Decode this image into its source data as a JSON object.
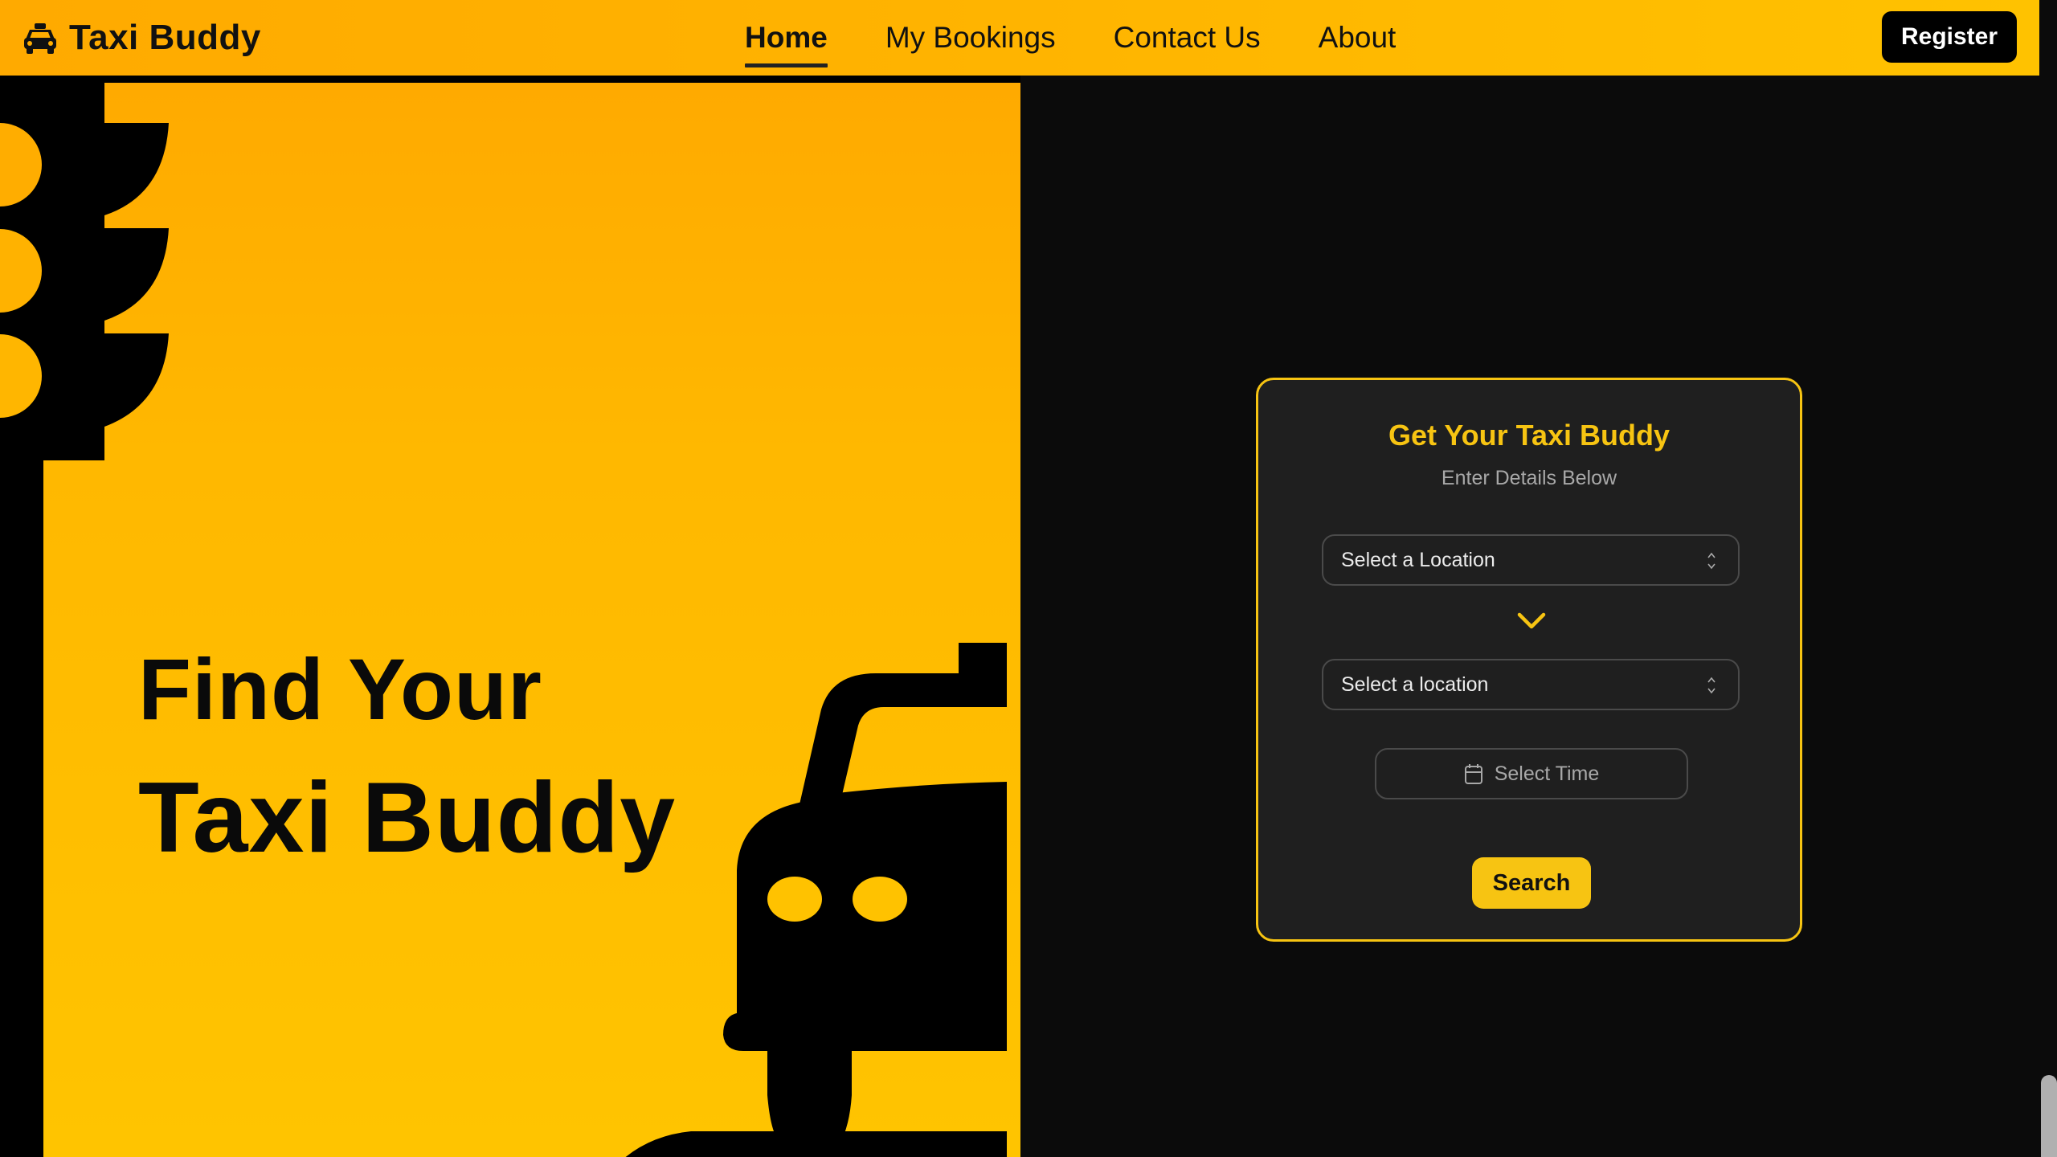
{
  "header": {
    "brand": "Taxi Buddy",
    "brand_icon": "taxi-icon",
    "nav": [
      {
        "label": "Home",
        "active": true
      },
      {
        "label": "My Bookings",
        "active": false
      },
      {
        "label": "Contact Us",
        "active": false
      },
      {
        "label": "About",
        "active": false
      }
    ],
    "register_label": "Register"
  },
  "hero": {
    "line1": "Find Your",
    "line2": "Taxi Buddy",
    "illustrations": [
      "traffic-light",
      "taxi-car"
    ]
  },
  "booking_card": {
    "title": "Get Your Taxi Buddy",
    "subtitle": "Enter Details Below",
    "pickup_select": {
      "value": "Select a Location"
    },
    "swap_icon": "chevron-down-icon",
    "dropoff_select": {
      "value": "Select a location"
    },
    "time_button": {
      "label": "Select Time",
      "icon": "calendar-icon"
    },
    "search_label": "Search"
  },
  "colors": {
    "header_bg_start": "#ffaa00",
    "header_bg_end": "#ffc200",
    "accent_yellow": "#f7c412",
    "card_bg": "#1f1f1f",
    "page_bg": "#0b0b0b"
  }
}
